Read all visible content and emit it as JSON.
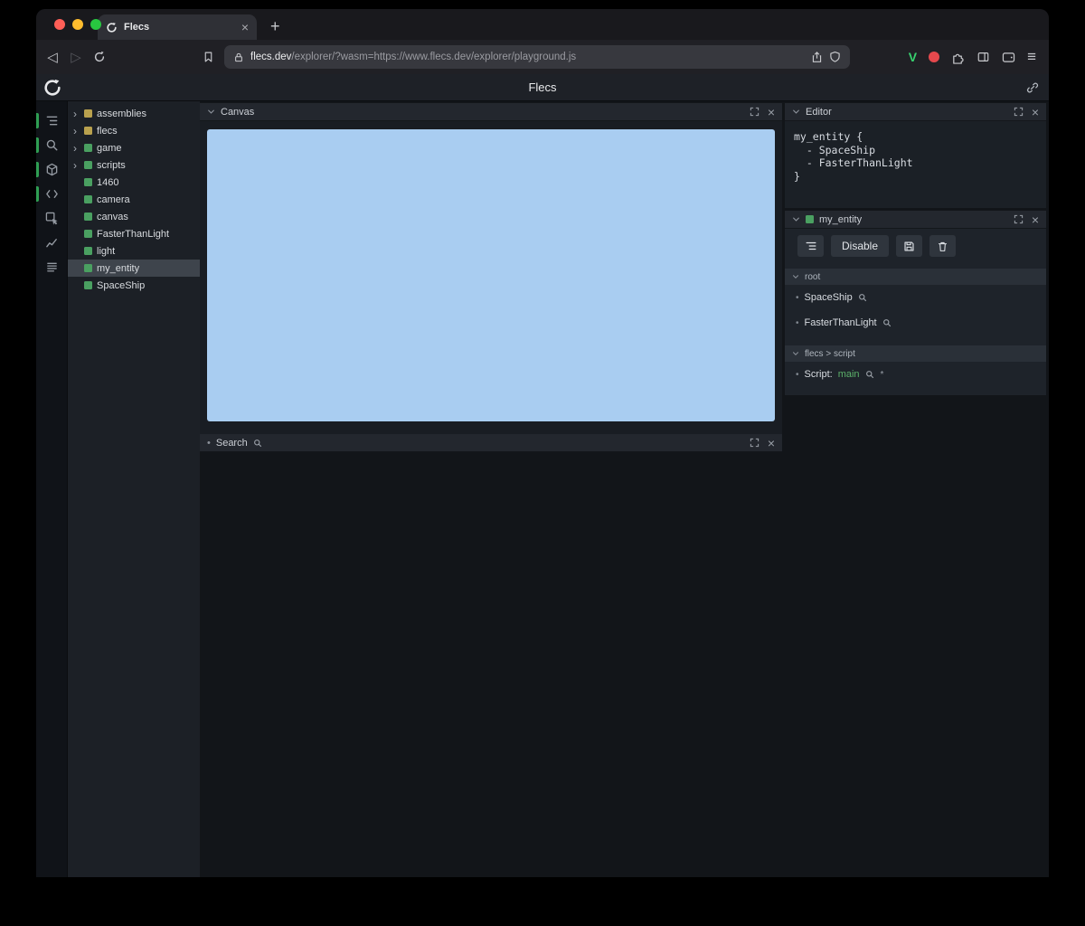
{
  "browser": {
    "tab_title": "Flecs",
    "url_host": "flecs.dev",
    "url_path": "/explorer/?wasm=https://www.flecs.dev/explorer/playground.js"
  },
  "app": {
    "title": "Flecs"
  },
  "tree": {
    "items": [
      {
        "label": "assemblies",
        "expandable": true,
        "color": "#b9a14e"
      },
      {
        "label": "flecs",
        "expandable": true,
        "color": "#b9a14e"
      },
      {
        "label": "game",
        "expandable": true,
        "color": "#4aa061"
      },
      {
        "label": "scripts",
        "expandable": true,
        "color": "#4aa061"
      },
      {
        "label": "1460",
        "expandable": false,
        "color": "#4aa061"
      },
      {
        "label": "camera",
        "expandable": false,
        "color": "#4aa061"
      },
      {
        "label": "canvas",
        "expandable": false,
        "color": "#4aa061"
      },
      {
        "label": "FasterThanLight",
        "expandable": false,
        "color": "#4aa061"
      },
      {
        "label": "light",
        "expandable": false,
        "color": "#4aa061"
      },
      {
        "label": "my_entity",
        "expandable": false,
        "color": "#4aa061",
        "selected": true
      },
      {
        "label": "SpaceShip",
        "expandable": false,
        "color": "#4aa061"
      }
    ]
  },
  "panels": {
    "canvas": {
      "title": "Canvas"
    },
    "search": {
      "title": "Search"
    },
    "editor": {
      "title": "Editor",
      "code_lines": [
        "my_entity {",
        "  - SpaceShip",
        "  - FasterThanLight",
        "}"
      ]
    },
    "entity": {
      "title": "my_entity",
      "disable_label": "Disable",
      "sections": [
        {
          "title": "root",
          "items": [
            {
              "text": "SpaceShip"
            },
            {
              "text": "FasterThanLight"
            }
          ]
        },
        {
          "title": "flecs > script",
          "items": [
            {
              "prefix": "Script: ",
              "value": "main"
            }
          ]
        }
      ]
    }
  },
  "colors": {
    "canvas_blue": "#a9cdf1",
    "entity_green": "#4aa061",
    "assembly_yellow": "#b9a14e",
    "script_value_green": "#5cb06a",
    "selected_row": "#3e444c"
  }
}
